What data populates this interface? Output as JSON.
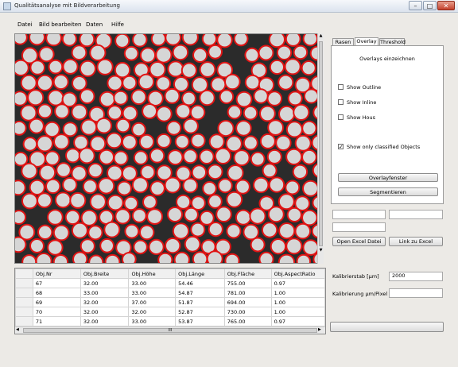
{
  "window": {
    "title": "Qualitätsanalyse mit Bildverarbeitung",
    "minimize_glyph": "–",
    "maximize_glyph": "□",
    "close_glyph": "✕"
  },
  "menu": {
    "items": [
      "Datei",
      "Bild bearbeiten",
      "Daten",
      "Hilfe"
    ]
  },
  "tabs": {
    "items": [
      "Rasen",
      "Overlay",
      "Threshold"
    ],
    "active_index": 1
  },
  "overlay_panel": {
    "heading": "Overlays einzeichnen",
    "checkboxes": [
      {
        "label": "Show Outline",
        "checked": false
      },
      {
        "label": "Show Inline",
        "checked": false
      },
      {
        "label": "Show Hous",
        "checked": false
      },
      {
        "label": "Show only classified Objects",
        "checked": true
      }
    ],
    "button_primary": "Overlayfenster",
    "button_secondary": "Segmentieren"
  },
  "side_fields": {
    "top_left": "",
    "top_right": "",
    "second_left": ""
  },
  "side_buttons": {
    "open_excel": "Open Excel Datei",
    "link_excel": "Link zu Excel"
  },
  "calibration": {
    "length_label": "Kalibrierstab [µm]",
    "length_value": "2000",
    "pixel_label": "Kalibrierung µm/Pixel",
    "pixel_value": ""
  },
  "grid": {
    "columns": [
      "Obj.Nr",
      "Obj.Breite",
      "Obj.Höhe",
      "Obj.Länge",
      "Obj.Fläche",
      "Obj.AspectRatio"
    ],
    "rows": [
      [
        "67",
        "32.00",
        "33.00",
        "54.46",
        "755.00",
        "0.97"
      ],
      [
        "68",
        "33.00",
        "33.00",
        "54.87",
        "781.00",
        "1.00"
      ],
      [
        "69",
        "32.00",
        "37.00",
        "51.87",
        "694.00",
        "1.00"
      ],
      [
        "70",
        "32.00",
        "32.00",
        "52.87",
        "730.00",
        "1.00"
      ],
      [
        "71",
        "32.00",
        "33.00",
        "53.87",
        "765.00",
        "0.97"
      ]
    ],
    "scroll_thumb_glyph": "III"
  },
  "colors": {
    "outline": "#e01414",
    "particle": "#d6d6d6",
    "background": "#2b2b2b"
  }
}
